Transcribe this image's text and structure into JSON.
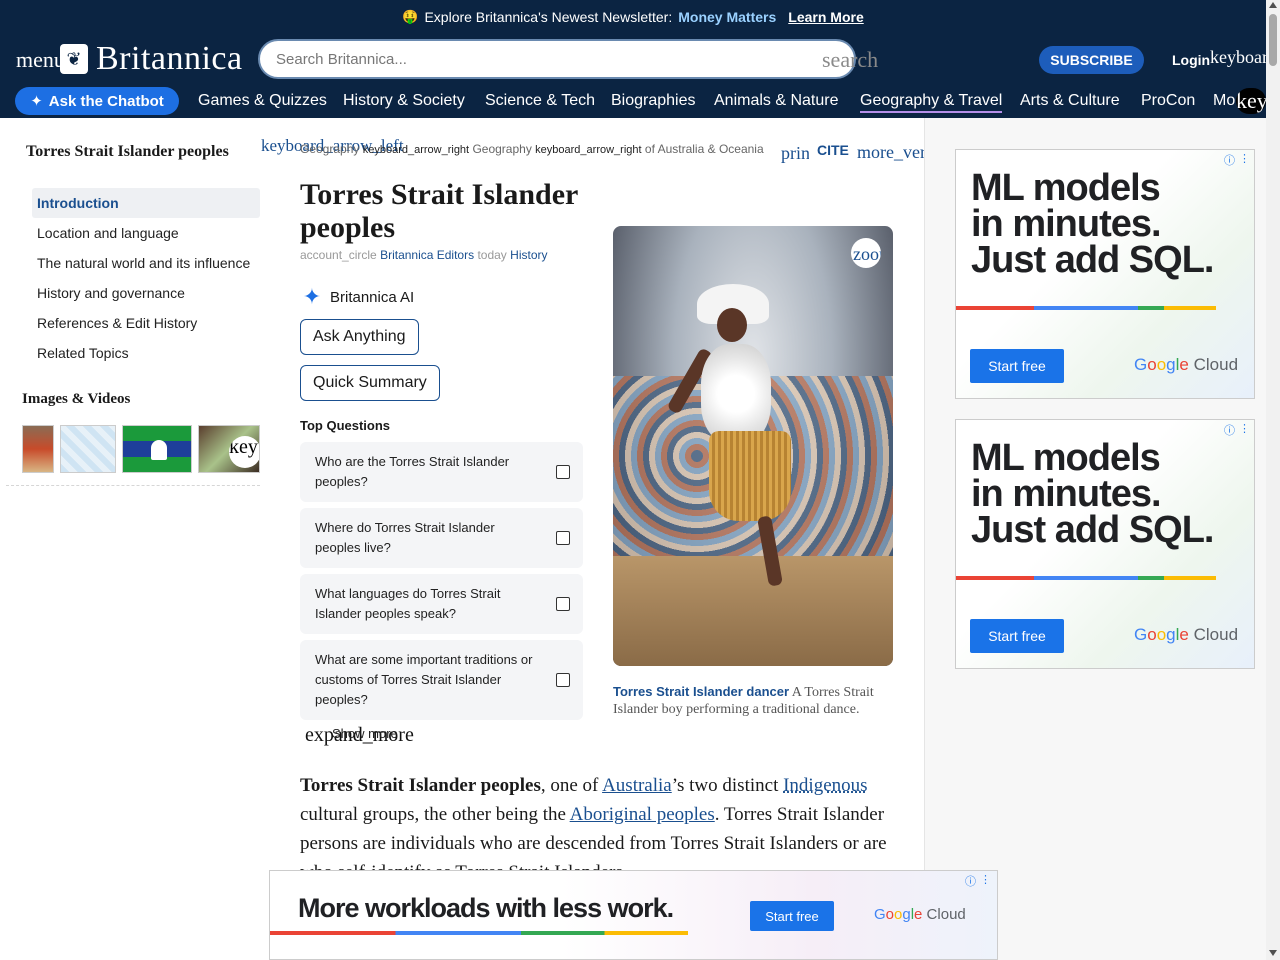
{
  "promo": {
    "emoji": "🤑",
    "text": "Explore Britannica's Newest Newsletter:",
    "accent": "Money Matters",
    "link": "Learn More"
  },
  "header": {
    "menu_icon": "menu",
    "logo_text": "Britannica",
    "search_placeholder": "Search Britannica...",
    "search_icon": "search",
    "subscribe": "SUBSCRIBE",
    "login": "Login",
    "login_icon": "keyboard_arrow_down",
    "chatbot": "Ask the Chatbot",
    "chatbot_icon": "✦",
    "nav": [
      "Games & Quizzes",
      "History & Society",
      "Science & Tech",
      "Biographies",
      "Animals & Nature",
      "Geography & Travel",
      "Arts & Culture",
      "ProCon",
      "Mo"
    ],
    "nav_more_icon": "keyboard_arrow_down"
  },
  "sidebar": {
    "title": "Torres Strait Islander peoples",
    "toc": [
      "Introduction",
      "Location and language",
      "The natural world and its influence",
      "History and governance",
      "References & Edit History",
      "Related Topics"
    ],
    "media_title": "Images & Videos",
    "thumb_next_icon": "keyboard_arrow_right"
  },
  "toolbar": {
    "back_icon": "keyboard_arrow_left",
    "breadcrumb": {
      "geo1": "Geography",
      "kb1": "keyboard_arrow_right",
      "geo2": "Geography",
      "kb2": "keyboard_arrow_right",
      "tail": "of Australia & Oceania"
    },
    "print_icon": "print",
    "cite": "CITE",
    "more_icon": "more_vert"
  },
  "article": {
    "title": "Torres Strait Islander peoples",
    "byline_account": "account_circle",
    "byline_authors": "Britannica Editors",
    "byline_today": "today",
    "byline_history": "History",
    "ai_label": "Britannica AI",
    "ai_icon": "✦",
    "ask_anything": "Ask Anything",
    "quick_summary": "Quick Summary",
    "top_questions_title": "Top Questions",
    "top_questions": [
      "Who are the Torres Strait Islander peoples?",
      "Where do Torres Strait Islander peoples live?",
      "What languages do Torres Strait Islander peoples speak?",
      "What are some important traditions or customs of Torres Strait Islander peoples?"
    ],
    "show_more": "Show more",
    "expand_icon": "expand_more",
    "figure": {
      "zoom_icon": "zoom_in",
      "caption_title": "Torres Strait Islander dancer",
      "caption_text": "A Torres Strait Islander boy performing a traditional dance."
    },
    "body": {
      "bold_start": "Torres Strait Islander peoples",
      "t1": ", one of ",
      "link1": "Australia",
      "t2": "’s two distinct ",
      "link2": "Indigenous",
      "t3": " cultural groups, the other being the ",
      "link3": "Aboriginal peoples",
      "t4": ". Torres Strait Islander persons are individuals who are descended from Torres Strait Islanders or are who self-identify as Torres Strait Islanders."
    }
  },
  "ads": {
    "headline_line1": "ML models",
    "headline_line2": "in minutes.",
    "headline_line3": "Just add SQL.",
    "cta": "Start free",
    "brand_g": "G",
    "brand_o1": "o",
    "brand_o2": "o",
    "brand_g2": "g",
    "brand_l": "l",
    "brand_e": "e",
    "brand_rest": " Cloud",
    "bottom_headline": "More workloads with less work.",
    "bottom_cta": "Start free",
    "info_icon": "ⓘ",
    "menu_dots": "⋮"
  }
}
